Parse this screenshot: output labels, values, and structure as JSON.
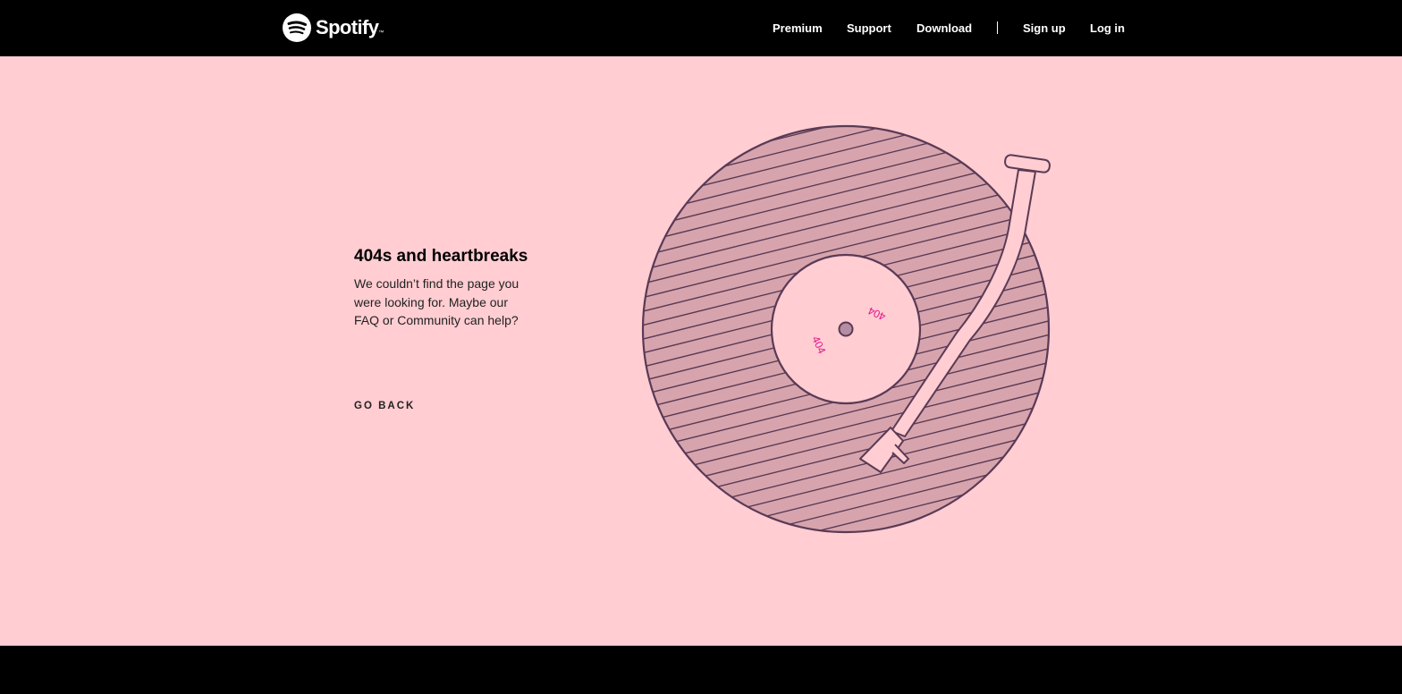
{
  "header": {
    "brand": "Spotify",
    "trademark": "™",
    "nav": {
      "premium": "Premium",
      "support": "Support",
      "download": "Download",
      "signup": "Sign up",
      "login": "Log in"
    }
  },
  "error": {
    "heading": "404s and heartbreaks",
    "desc_before": "We couldn’t find the page you were looking for. Maybe our ",
    "faq_link": "FAQ",
    "desc_middle": " or ",
    "community_link": "Community",
    "desc_after": " can help?",
    "go_back": "GO BACK"
  },
  "illustration": {
    "label_text": "404",
    "icon": "turntable-record-illustration"
  },
  "colors": {
    "page_bg": "#ffcdd2",
    "record_fill": "#d7a4ad",
    "outline": "#5a3a55",
    "label_text": "#e4168c",
    "bar_bg": "#000000"
  }
}
